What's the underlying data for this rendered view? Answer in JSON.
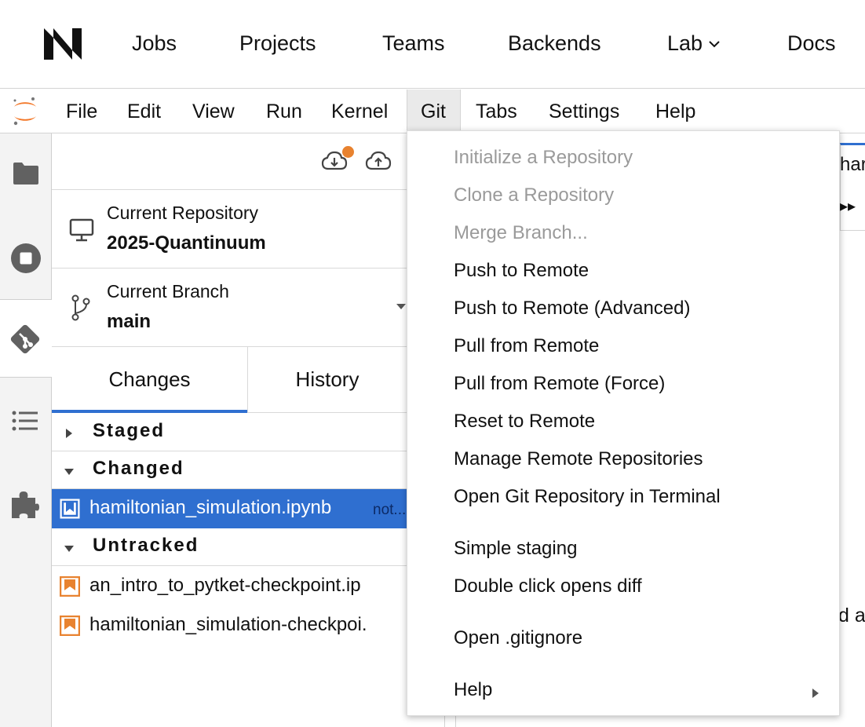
{
  "topnav": {
    "items": [
      "Jobs",
      "Projects",
      "Teams",
      "Backends",
      "Lab",
      "Docs"
    ]
  },
  "menubar": {
    "items": [
      "File",
      "Edit",
      "View",
      "Run",
      "Kernel",
      "Git",
      "Tabs",
      "Settings",
      "Help"
    ]
  },
  "activity_bar": {
    "icons": [
      "folder-icon",
      "stop-circle-icon",
      "git-icon",
      "list-icon",
      "puzzle-icon"
    ]
  },
  "git_panel": {
    "repo_label": "Current Repository",
    "repo_name": "2025-Quantinuum",
    "branch_label": "Current Branch",
    "branch_name": "main",
    "tabs": [
      "Changes",
      "History"
    ],
    "sections": {
      "staged": "Staged",
      "changed": "Changed",
      "untracked": "Untracked"
    },
    "changed_files": [
      {
        "name": "hamiltonian_simulation.ipynb",
        "status": "not..."
      }
    ],
    "untracked_files": [
      {
        "name": "an_intro_to_pytket-checkpoint.ip"
      },
      {
        "name": "hamiltonian_simulation-checkpoi."
      }
    ],
    "colors": {
      "accent": "#2f6fd0",
      "notify": "#e8822f",
      "notebook_icon": "#e8822f"
    }
  },
  "notebook": {
    "tab_fragment": "har",
    "run_all": "▸▸",
    "text_fragment": "d a"
  },
  "git_menu": {
    "items": [
      {
        "label": "Initialize a Repository",
        "disabled": true
      },
      {
        "label": "Clone a Repository",
        "disabled": true
      },
      {
        "label": "Merge Branch...",
        "disabled": true
      },
      {
        "label": "Push to Remote",
        "disabled": false
      },
      {
        "label": "Push to Remote (Advanced)",
        "disabled": false
      },
      {
        "label": "Pull from Remote",
        "disabled": false
      },
      {
        "label": "Pull from Remote (Force)",
        "disabled": false
      },
      {
        "label": "Reset to Remote",
        "disabled": false
      },
      {
        "label": "Manage Remote Repositories",
        "disabled": false
      },
      {
        "label": "Open Git Repository in Terminal",
        "disabled": false
      },
      {
        "label": "Simple staging",
        "disabled": false
      },
      {
        "label": "Double click opens diff",
        "disabled": false
      },
      {
        "label": "Open .gitignore",
        "disabled": false
      },
      {
        "label": "Help",
        "disabled": false
      }
    ]
  }
}
